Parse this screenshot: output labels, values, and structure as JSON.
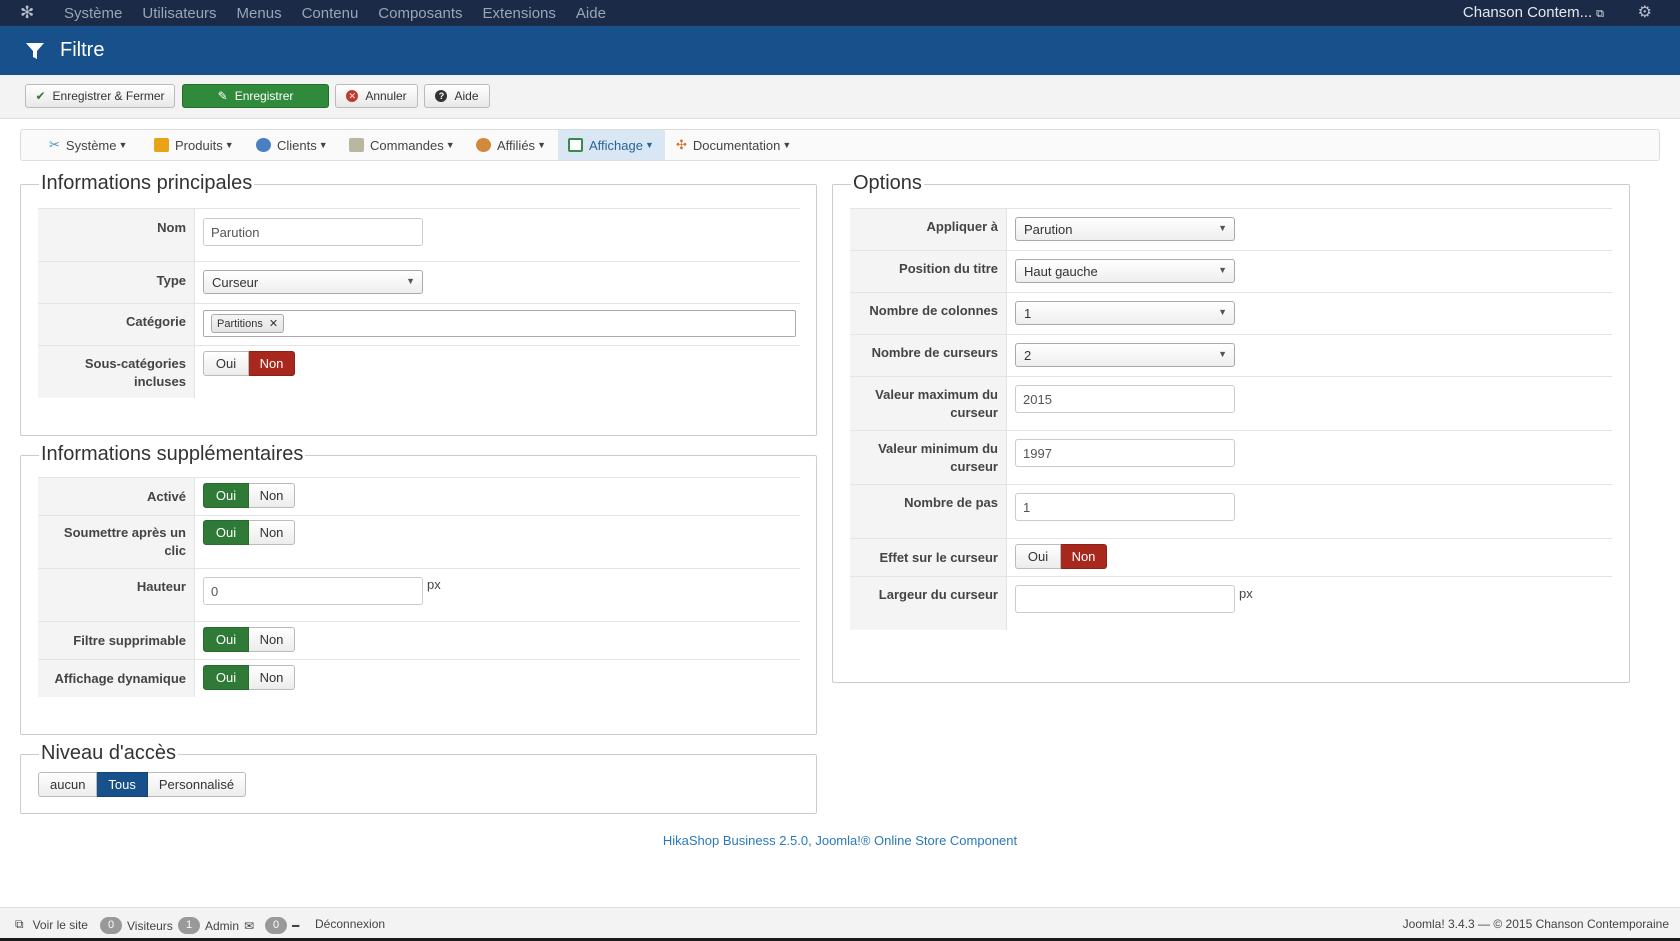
{
  "topnav": {
    "menu": [
      "Système",
      "Utilisateurs",
      "Menus",
      "Contenu",
      "Composants",
      "Extensions",
      "Aide"
    ],
    "site_title": "Chanson Contem...",
    "icons": [
      "joomla-logo-icon",
      "external-link-icon",
      "gear-icon"
    ]
  },
  "header": {
    "title": "Filtre"
  },
  "toolbar": {
    "save_close": "Enregistrer & Fermer",
    "save": "Enregistrer",
    "cancel": "Annuler",
    "help": "Aide"
  },
  "submenu": {
    "items": [
      "Système",
      "Produits",
      "Clients",
      "Commandes",
      "Affiliés",
      "Affichage",
      "Documentation"
    ],
    "active": "Affichage"
  },
  "main": {
    "legend": "Informations principales",
    "nom_label": "Nom",
    "nom_value": "Parution",
    "type_label": "Type",
    "type_value": "Curseur",
    "categorie_label": "Catégorie",
    "categorie_tag": "Partitions",
    "souscat_label": "Sous-catégories incluses",
    "souscat_yes": "Oui",
    "souscat_no": "Non",
    "souscat_selected": "Non"
  },
  "extra": {
    "legend": "Informations supplémentaires",
    "active_label": "Activé",
    "submit_label": "Soumettre après un clic",
    "height_label": "Hauteur",
    "height_value": "0",
    "height_unit": "px",
    "deletable_label": "Filtre supprimable",
    "dynamic_label": "Affichage dynamique",
    "yes": "Oui",
    "no": "Non",
    "active_selected": "Oui",
    "submit_selected": "Oui",
    "deletable_selected": "Oui",
    "dynamic_selected": "Oui"
  },
  "access": {
    "legend": "Niveau d'accès",
    "options": [
      "aucun",
      "Tous",
      "Personnalisé"
    ],
    "selected": "Tous"
  },
  "options": {
    "legend": "Options",
    "apply_label": "Appliquer à",
    "apply_value": "Parution",
    "title_pos_label": "Position du titre",
    "title_pos_value": "Haut gauche",
    "columns_label": "Nombre de colonnes",
    "columns_value": "1",
    "cursors_label": "Nombre de curseurs",
    "cursors_value": "2",
    "max_label": "Valeur maximum du curseur",
    "max_value": "2015",
    "min_label": "Valeur minimum du curseur",
    "min_value": "1997",
    "step_label": "Nombre de pas",
    "step_value": "1",
    "effect_label": "Effet sur le curseur",
    "effect_yes": "Oui",
    "effect_no": "Non",
    "effect_selected": "Non",
    "width_label": "Largeur du curseur",
    "width_value": "",
    "width_unit": "px"
  },
  "footer": {
    "credit": "HikaShop Business 2.5.0, Joomla!® Online Store Component"
  },
  "statusbar": {
    "view_site": "Voir le site",
    "visitors_count": "0",
    "visitors_label": "Visiteurs",
    "admin_count": "1",
    "admin_label": "Admin",
    "messages_count": "0",
    "logout": "Déconnexion",
    "version_text": "Joomla! 3.4.3  —  © 2015 Chanson Contemporaine"
  },
  "colors": {
    "header_blue": "#17508b",
    "topnav": "#1a2a47",
    "save_green": "#2f8a3c",
    "toggle_green": "#2f7a36",
    "toggle_red": "#a8281e",
    "link_blue": "#2a7ab8"
  }
}
